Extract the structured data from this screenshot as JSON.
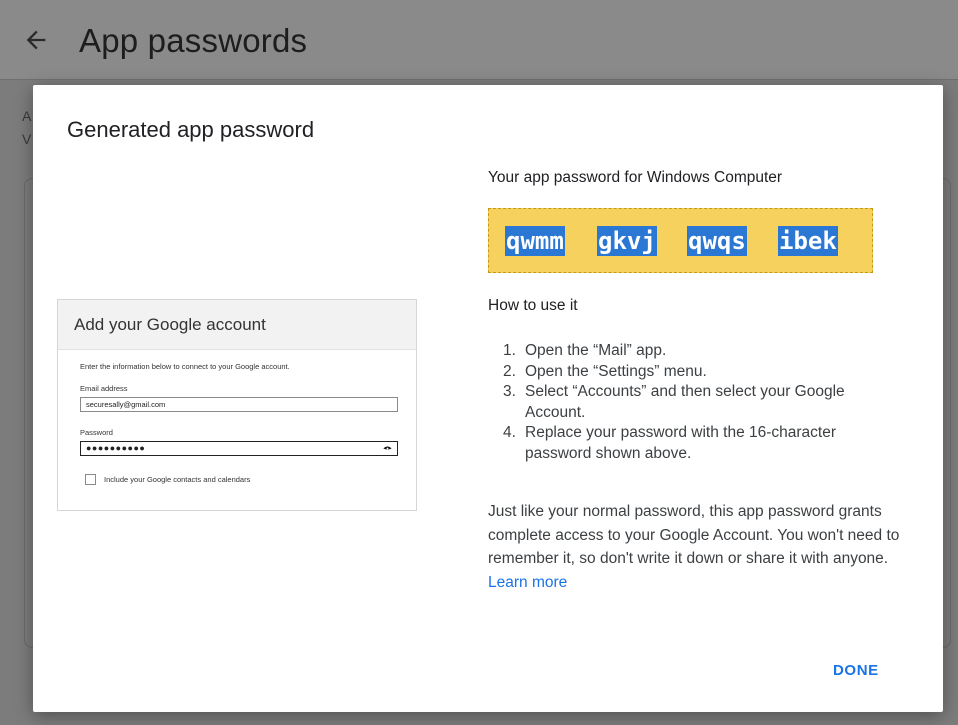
{
  "page": {
    "title": "App passwords",
    "background_text_fragments": [
      "A",
      "V"
    ]
  },
  "icons": {
    "back": "arrow-left-icon",
    "reveal": "eye-icon",
    "checkbox": "checkbox-unchecked-icon"
  },
  "dialog": {
    "title": "Generated app password",
    "password_for": "Your app password for Windows Computer",
    "password_chunks": [
      "qwmm",
      "gkvj",
      "qwqs",
      "ibek"
    ],
    "how_title": "How to use it",
    "steps": [
      {
        "number": "1.",
        "text": "Open the “Mail” app."
      },
      {
        "number": "2.",
        "text": "Open the “Settings” menu."
      },
      {
        "number": "3.",
        "text": "Select “Accounts” and then select your Google Account."
      },
      {
        "number": "4.",
        "text": "Replace your password with the 16-character password shown above."
      }
    ],
    "body_text": "Just like your normal password, this app password grants complete access to your Google Account. You won't need to remember it, so don't write it down or share it with anyone.",
    "learn_more": "Learn more",
    "done_label": "DONE"
  },
  "illustration": {
    "title": "Add your Google account",
    "info": "Enter the information below to connect to your Google account.",
    "email_label": "Email address",
    "email_value": "securesally@gmail.com",
    "password_label": "Password",
    "password_value": "●●●●●●●●●●",
    "checkbox_label": "Include your Google contacts and calendars"
  },
  "colors": {
    "password_box": "#f6d15d",
    "password_highlight": "#2b78d4",
    "link": "#1a73e8",
    "overlay": "#7c7c7c"
  }
}
